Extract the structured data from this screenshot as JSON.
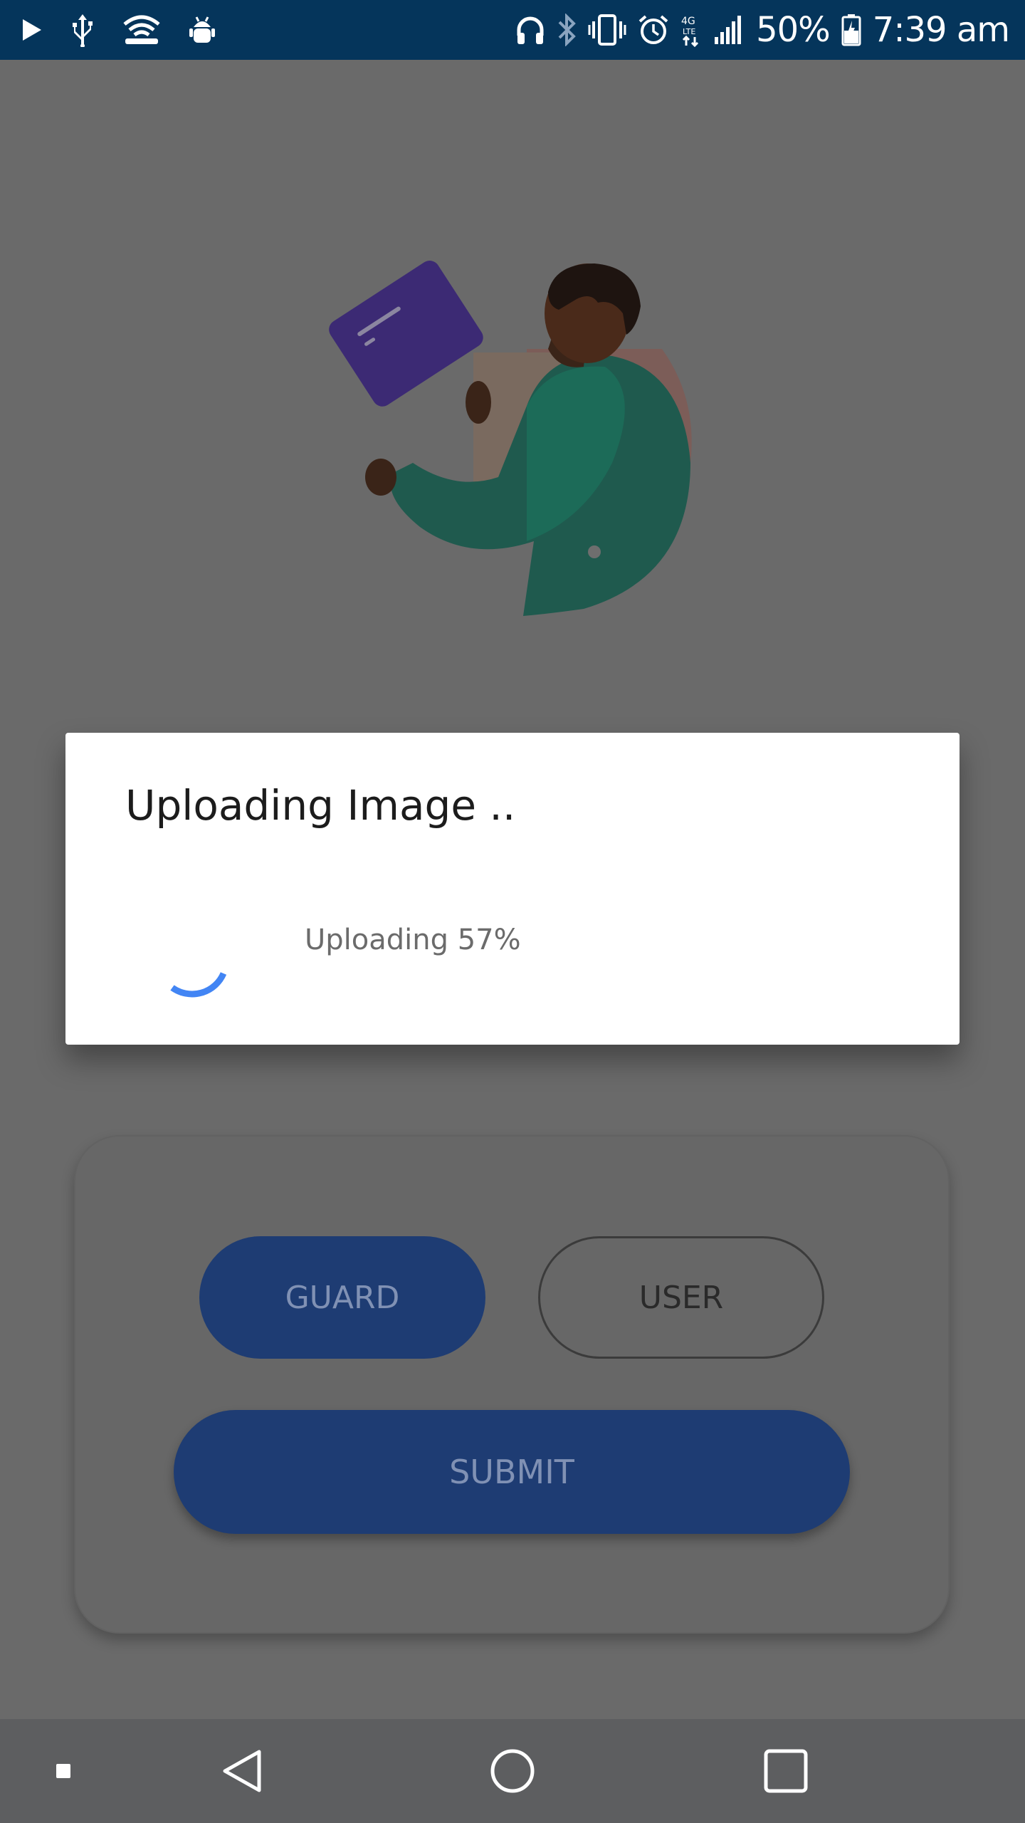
{
  "status_bar": {
    "battery": "50%",
    "time": "7:39 am",
    "icons_left": [
      "play-icon",
      "usb-icon",
      "wifi-hotspot-icon",
      "android-debug-icon"
    ],
    "icons_right": [
      "headset-icon",
      "bluetooth-icon",
      "vibrate-icon",
      "alarm-icon",
      "lte-4g-icon",
      "signal-icon",
      "battery-icon"
    ]
  },
  "colors": {
    "status_bar_bg": "#05355b",
    "scrim": "#6a6a6a",
    "primary_button": "#1e3c73",
    "spinner": "#4285f4",
    "nav_bar_bg": "#5d5e60"
  },
  "role_selector": {
    "guard_label": "GUARD",
    "user_label": "USER",
    "selected": "GUARD"
  },
  "submit_label": "SUBMIT",
  "dialog": {
    "title": "Uploading Image ..",
    "progress_text": "Uploading 57%",
    "progress": 0.57
  },
  "nav_bar": {
    "icons": [
      "recent-dot-icon",
      "back-icon",
      "home-icon",
      "overview-icon"
    ]
  }
}
